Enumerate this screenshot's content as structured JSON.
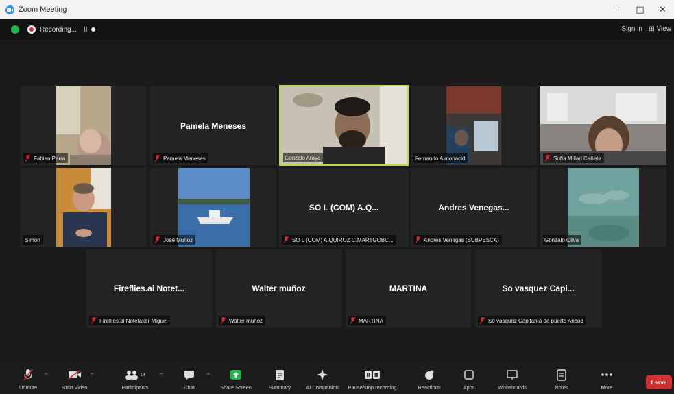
{
  "window": {
    "title": "Zoom Meeting",
    "minimize": "–",
    "maximize": "□",
    "close": "✕"
  },
  "topbar": {
    "recording_text": "Recording...",
    "pause": "II",
    "sign_in": "Sign in",
    "view": "⊞ View"
  },
  "participants": [
    {
      "display_name": "",
      "label": "Fabian Parra",
      "muted": true,
      "video": true
    },
    {
      "display_name": "Pamela Meneses",
      "label": "Pamela Meneses",
      "muted": true,
      "video": false
    },
    {
      "display_name": "",
      "label": "Gonzalo Araya",
      "muted": false,
      "video": true,
      "active_speaker": true
    },
    {
      "display_name": "",
      "label": "Fernando Almonacid",
      "muted": false,
      "video": true
    },
    {
      "display_name": "",
      "label": "Sofía Millad Cañete",
      "muted": true,
      "video": true
    },
    {
      "display_name": "",
      "label": "Simon",
      "muted": false,
      "video": true
    },
    {
      "display_name": "",
      "label": "Jose Muñoz",
      "muted": true,
      "video": true
    },
    {
      "display_name": "SO L (COM) A.Q...",
      "label": "SO L (COM) A.QUIROZ C.MARTGOBC...",
      "muted": true,
      "video": false
    },
    {
      "display_name": "Andres Venegas...",
      "label": "Andres Venegas (SUBPESCA)",
      "muted": true,
      "video": false
    },
    {
      "display_name": "",
      "label": "Gonzalo Oliva",
      "muted": false,
      "video": true
    },
    {
      "display_name": "Fireflies.ai Notet...",
      "label": "Fireflies.ai Notetaker Miguel",
      "muted": true,
      "video": false
    },
    {
      "display_name": "Walter muñoz",
      "label": "Walter muñoz",
      "muted": true,
      "video": false
    },
    {
      "display_name": "MARTINA",
      "label": "MARTINA",
      "muted": true,
      "video": false
    },
    {
      "display_name": "So vasquez Capi...",
      "label": "So vasquez Capitanía de puerto Ancud",
      "muted": true,
      "video": false
    }
  ],
  "toolbar": {
    "unmute": "Unmute",
    "start_video": "Start Video",
    "participants": "Participants",
    "participants_count": "14",
    "chat": "Chat",
    "share_screen": "Share Screen",
    "summary": "Summary",
    "ai_companion": "AI Companion",
    "pause_recording": "Pause/stop recording",
    "reactions": "Reactions",
    "apps": "Apps",
    "whiteboards": "Whiteboards",
    "notes": "Notes",
    "more": "More",
    "leave": "Leave"
  },
  "colors": {
    "share_screen": "#23b34c",
    "leave": "#d32f2f",
    "active_speaker_border": "#b6dc4a",
    "muted_icon": "#e02828"
  }
}
